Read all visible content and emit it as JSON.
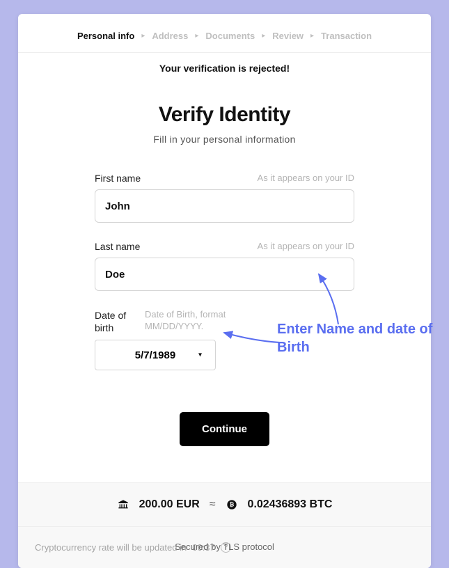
{
  "breadcrumb": {
    "items": [
      "Personal info",
      "Address",
      "Documents",
      "Review",
      "Transaction"
    ],
    "active_index": 0
  },
  "status_banner": "Your verification is rejected!",
  "heading": {
    "title": "Verify Identity",
    "subtitle": "Fill in your personal information"
  },
  "form": {
    "first_name": {
      "label": "First name",
      "hint": "As it appears on your ID",
      "value": "John"
    },
    "last_name": {
      "label": "Last name",
      "hint": "As it appears on your ID",
      "value": "Doe"
    },
    "dob": {
      "label": "Date of birth",
      "hint": "Date of Birth, format MM/DD/YYYY.",
      "value": "5/7/1989"
    },
    "continue_label": "Continue"
  },
  "summary": {
    "fiat_amount": "200.00 EUR",
    "approx": "≈",
    "crypto_amount": "0.02436893 BTC"
  },
  "footer": {
    "rate_text_prefix": "Cryptocurrency rate will be updated in ",
    "rate_timer": "00:37"
  },
  "secured_text": "Secured by TLS protocol",
  "annotation": {
    "text": "Enter Name and date of Birth"
  }
}
